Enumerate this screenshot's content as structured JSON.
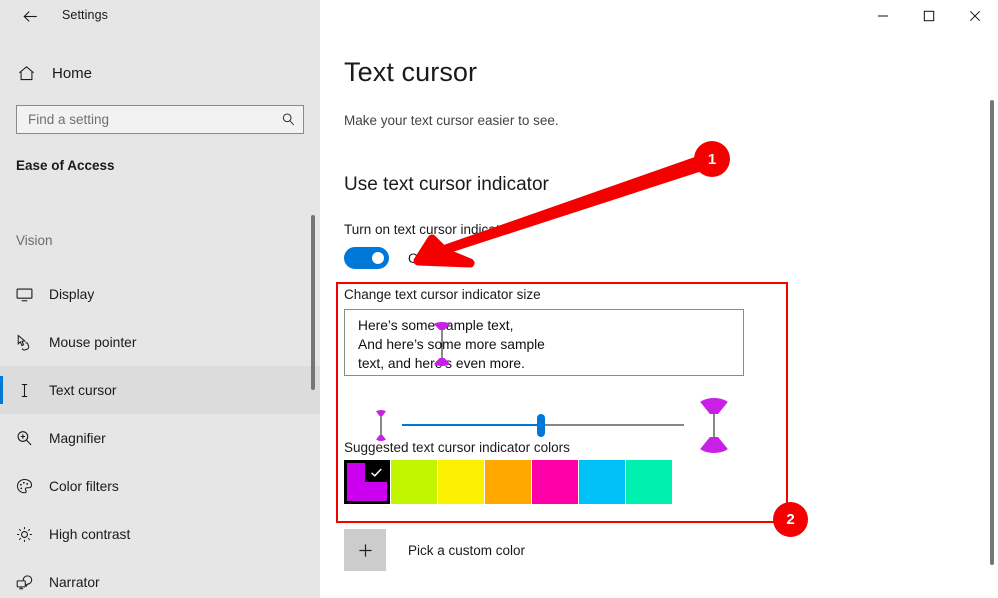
{
  "window": {
    "title": "Settings",
    "back_icon": "back-arrow-icon",
    "minimize_label": "─",
    "maximize_label": "☐",
    "close_label": "✕"
  },
  "sidebar": {
    "home_label": "Home",
    "home_icon": "home-icon",
    "search": {
      "placeholder": "Find a setting",
      "value": "",
      "icon": "search-icon"
    },
    "category_title": "Ease of Access",
    "group_label": "Vision",
    "items": [
      {
        "label": "Display",
        "icon": "monitor-icon",
        "selected": false
      },
      {
        "label": "Mouse pointer",
        "icon": "mouse-pointer-icon",
        "selected": false
      },
      {
        "label": "Text cursor",
        "icon": "text-cursor-icon",
        "selected": true
      },
      {
        "label": "Magnifier",
        "icon": "magnifier-icon",
        "selected": false
      },
      {
        "label": "Color filters",
        "icon": "palette-icon",
        "selected": false
      },
      {
        "label": "High contrast",
        "icon": "brightness-icon",
        "selected": false
      },
      {
        "label": "Narrator",
        "icon": "narrator-icon",
        "selected": false
      }
    ]
  },
  "main": {
    "page_title": "Text cursor",
    "page_subtitle": "Make your text cursor easier to see.",
    "section_heading": "Use text cursor indicator",
    "toggle_label": "Turn on text cursor indicator",
    "toggle_state": "On",
    "toggle_on": true,
    "size_label": "Change text cursor indicator size",
    "preview_text": "Here’s some sample text,\nAnd here’s some more sample\ntext, and here’s even more.",
    "slider": {
      "value_percent": 49,
      "min_preview_caption": "small-cursor-preview",
      "max_preview_caption": "large-cursor-preview"
    },
    "colors_label": "Suggested text cursor indicator colors",
    "swatches": [
      {
        "name": "magenta",
        "hex": "#cc00ee",
        "selected": true
      },
      {
        "name": "lime",
        "hex": "#c2f500"
      },
      {
        "name": "yellow",
        "hex": "#fbf000"
      },
      {
        "name": "orange",
        "hex": "#ffa800"
      },
      {
        "name": "pink",
        "hex": "#ff00a8"
      },
      {
        "name": "cyan",
        "hex": "#00c0f8"
      },
      {
        "name": "spring-green",
        "hex": "#00f0b0"
      }
    ],
    "custom_color_label": "Pick a custom color",
    "custom_color_icon": "plus-icon"
  },
  "annotations": {
    "accent_color": "#f40000",
    "badge_1": "1",
    "badge_2": "2"
  }
}
